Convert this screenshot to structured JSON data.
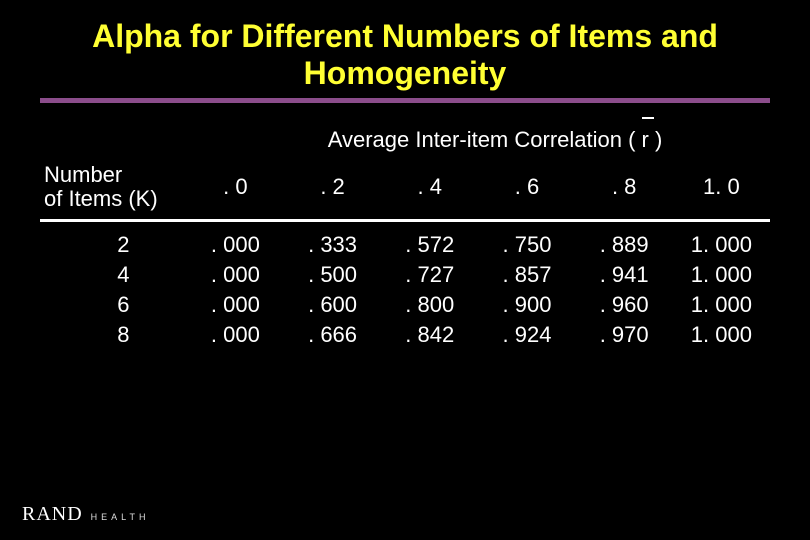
{
  "title": "Alpha for Different Numbers of Items and Homogeneity",
  "subhead_prefix": "Average Inter-item Correlation ( ",
  "subhead_r": "r",
  "subhead_suffix": " )",
  "row_header": "Number\nof Items (K)",
  "col_headers": [
    ". 0",
    ". 2",
    ". 4",
    ". 6",
    ". 8",
    "1. 0"
  ],
  "rows": [
    {
      "k": "2",
      "v": [
        ". 000",
        ". 333",
        ". 572",
        ". 750",
        ". 889",
        "1. 000"
      ]
    },
    {
      "k": "4",
      "v": [
        ". 000",
        ". 500",
        ". 727",
        ". 857",
        ". 941",
        "1. 000"
      ]
    },
    {
      "k": "6",
      "v": [
        ". 000",
        ". 600",
        ". 800",
        ". 900",
        ". 960",
        "1. 000"
      ]
    },
    {
      "k": "8",
      "v": [
        ". 000",
        ". 666",
        ". 842",
        ". 924",
        ". 970",
        "1. 000"
      ]
    }
  ],
  "footer_brand": "RAND",
  "footer_sub": "HEALTH",
  "chart_data": {
    "type": "table",
    "title": "Alpha for Different Numbers of Items and Homogeneity",
    "row_variable": "Number of Items (K)",
    "column_variable": "Average Inter-item Correlation (r)",
    "columns": [
      0.0,
      0.2,
      0.4,
      0.6,
      0.8,
      1.0
    ],
    "rows": [
      {
        "K": 2,
        "alpha": [
          0.0,
          0.333,
          0.572,
          0.75,
          0.889,
          1.0
        ]
      },
      {
        "K": 4,
        "alpha": [
          0.0,
          0.5,
          0.727,
          0.857,
          0.941,
          1.0
        ]
      },
      {
        "K": 6,
        "alpha": [
          0.0,
          0.6,
          0.8,
          0.9,
          0.96,
          1.0
        ]
      },
      {
        "K": 8,
        "alpha": [
          0.0,
          0.666,
          0.842,
          0.924,
          0.97,
          1.0
        ]
      }
    ]
  }
}
